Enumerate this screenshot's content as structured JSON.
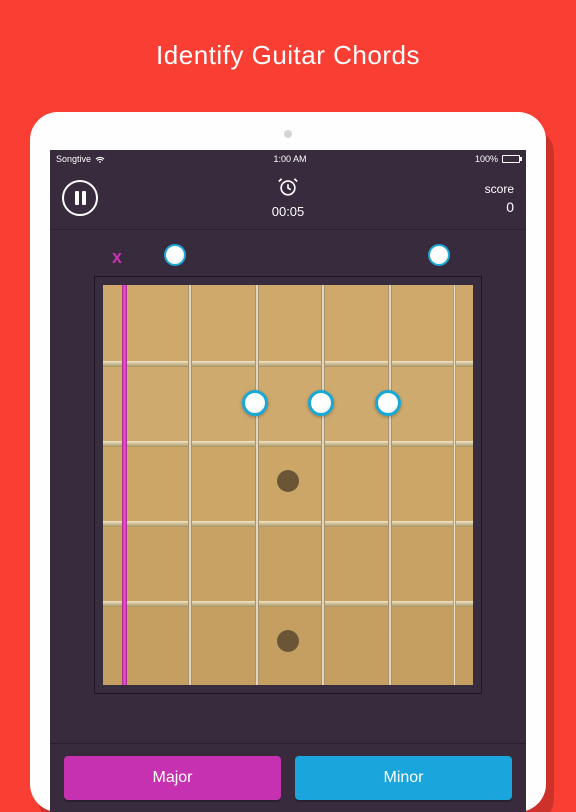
{
  "title": "Identify Guitar Chords",
  "status": {
    "carrier": "Songtive",
    "time": "1:00 AM",
    "battery_pct": "100%"
  },
  "header": {
    "timer": "00:05",
    "score_label": "score",
    "score_value": "0"
  },
  "chord": {
    "nut": [
      "x",
      "o",
      "",
      "",
      "",
      "o"
    ],
    "fingers": [
      {
        "string": 3,
        "fret": 2
      },
      {
        "string": 4,
        "fret": 2
      },
      {
        "string": 5,
        "fret": 2
      }
    ],
    "highlight_string": 1
  },
  "answers": {
    "major": "Major",
    "minor": "Minor"
  }
}
